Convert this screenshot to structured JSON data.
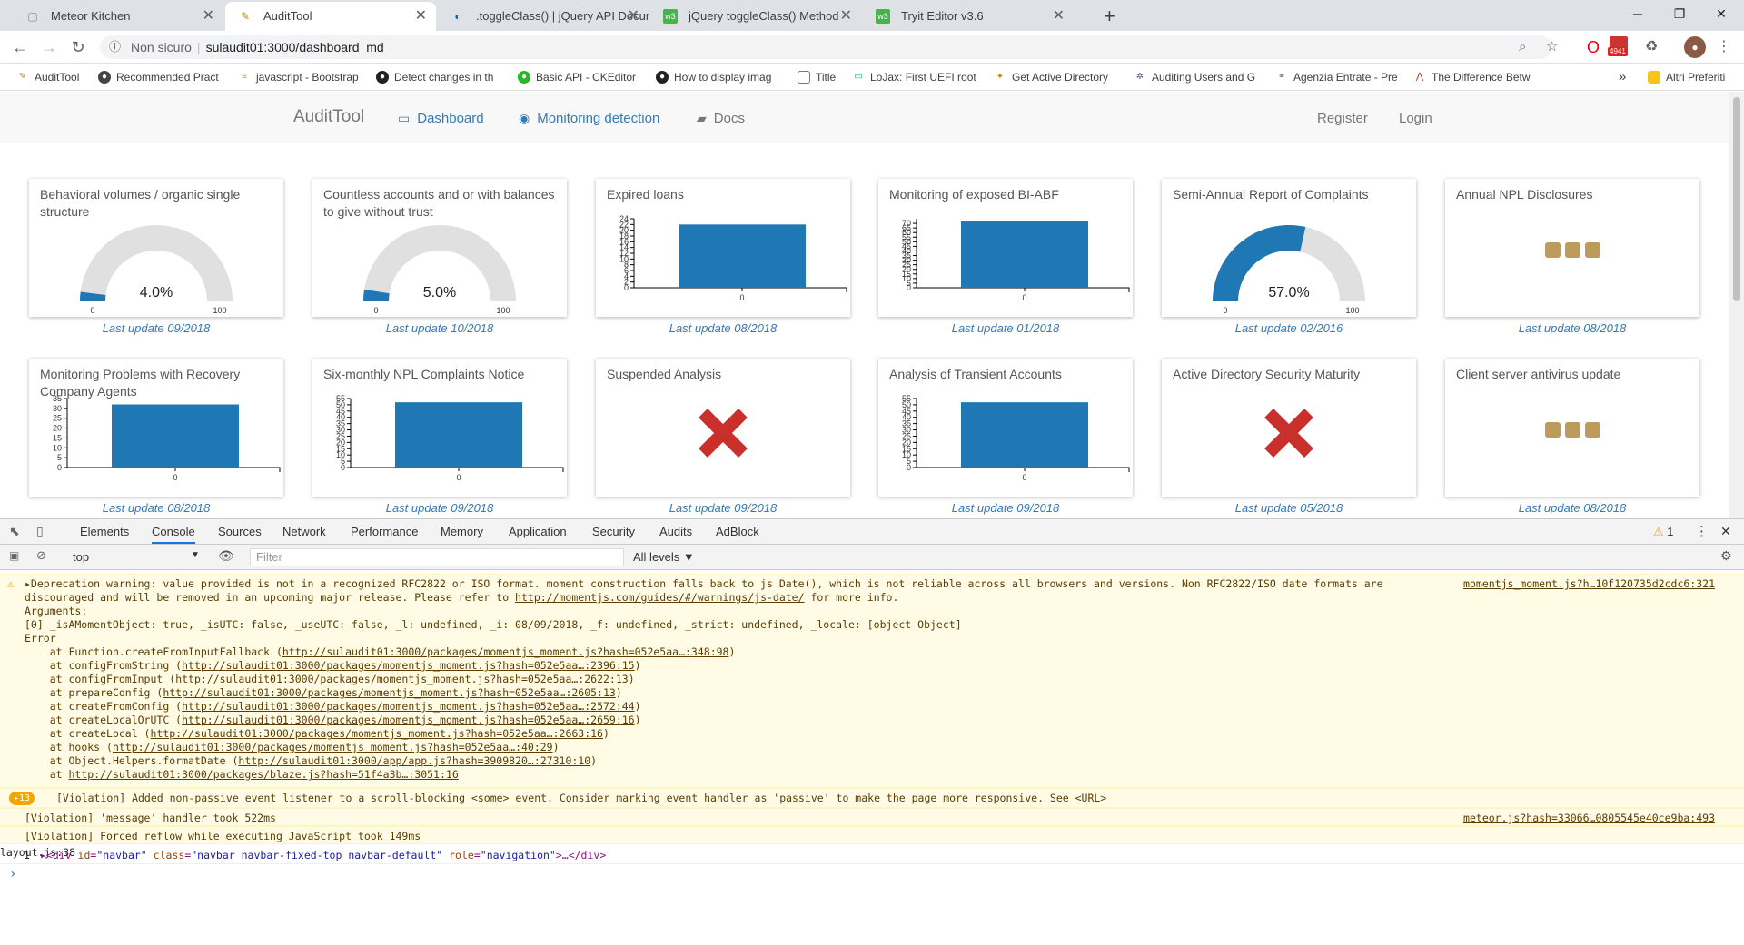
{
  "browser": {
    "tabs": [
      {
        "title": "Meteor Kitchen",
        "active": false
      },
      {
        "title": "AuditTool",
        "active": true
      },
      {
        "title": ".toggleClass() | jQuery API Docum",
        "active": false
      },
      {
        "title": "jQuery toggleClass() Method",
        "active": false
      },
      {
        "title": "Tryit Editor v3.6",
        "active": false
      }
    ],
    "url_security": "Non sicuro",
    "url": "sulaudit01:3000/dashboard_md",
    "ext_badge": "4941",
    "bookmarks": [
      "AuditTool",
      "Recommended Pract",
      "javascript - Bootstrap",
      "Detect changes in th",
      "Basic API - CKEditor",
      "How to display imag",
      "Title",
      "LoJax: First UEFI root",
      "Get Active Directory",
      "Auditing Users and G",
      "Agenzia Entrate - Pre",
      "The Difference Betw"
    ],
    "bookmarks_overflow": "»",
    "other_bookmarks": "Altri Preferiti"
  },
  "navbar": {
    "brand": "AuditTool",
    "dashboard": "Dashboard",
    "monitoring": "Monitoring detection",
    "docs": "Docs",
    "register": "Register",
    "login": "Login"
  },
  "widgets": [
    {
      "title": "Behavioral volumes / organic single structure",
      "type": "gauge",
      "value": 4.0,
      "label": "4.0%",
      "min": "0",
      "max": "100",
      "update": "Last update 09/2018"
    },
    {
      "title": "Countless accounts and or with balances to give without trust",
      "type": "gauge",
      "value": 5.0,
      "label": "5.0%",
      "min": "0",
      "max": "100",
      "update": "Last update 10/2018"
    },
    {
      "title": "Expired loans",
      "type": "bar",
      "value": 22,
      "ymax": 24,
      "ticks": [
        "0",
        "2",
        "4",
        "6",
        "8",
        "10",
        "12",
        "14",
        "16",
        "18",
        "20",
        "22",
        "24"
      ],
      "xcat": "0",
      "update": "Last update 08/2018"
    },
    {
      "title": "Monitoring of exposed BI-ABF",
      "type": "bar",
      "value": 72,
      "ymax": 75,
      "ticks": [
        "0",
        "5",
        "10",
        "15",
        "20",
        "25",
        "30",
        "35",
        "40",
        "45",
        "50",
        "55",
        "60",
        "65",
        "70"
      ],
      "xcat": "0",
      "update": "Last update 01/2018"
    },
    {
      "title": "Semi-Annual Report of Complaints",
      "type": "gauge",
      "value": 57.0,
      "label": "57.0%",
      "min": "0",
      "max": "100",
      "update": "Last update 02/2016"
    },
    {
      "title": "Annual NPL Disclosures",
      "type": "loading",
      "update": "Last update 08/2018"
    },
    {
      "title": "Monitoring Problems with Recovery Company Agents",
      "type": "bar",
      "value": 32,
      "ymax": 35,
      "ticks": [
        "0",
        "5",
        "10",
        "15",
        "20",
        "25",
        "30",
        "35"
      ],
      "xcat": "0",
      "update": "Last update 08/2018"
    },
    {
      "title": "Six-monthly NPL Complaints Notice",
      "type": "bar",
      "value": 52,
      "ymax": 55,
      "ticks": [
        "0",
        "5",
        "10",
        "15",
        "20",
        "25",
        "30",
        "35",
        "40",
        "45",
        "50",
        "55"
      ],
      "xcat": "0",
      "update": "Last update 09/2018"
    },
    {
      "title": "Suspended Analysis",
      "type": "error",
      "update": "Last update 09/2018"
    },
    {
      "title": "Analysis of Transient Accounts",
      "type": "bar",
      "value": 52,
      "ymax": 55,
      "ticks": [
        "0",
        "5",
        "10",
        "15",
        "20",
        "25",
        "30",
        "35",
        "40",
        "45",
        "50",
        "55"
      ],
      "xcat": "0",
      "update": "Last update 09/2018"
    },
    {
      "title": "Active Directory Security Maturity",
      "type": "error",
      "update": "Last update 05/2018"
    },
    {
      "title": "Client server antivirus update",
      "type": "loading",
      "update": "Last update 08/2018"
    }
  ],
  "devtools": {
    "tabs": [
      "Elements",
      "Console",
      "Sources",
      "Network",
      "Performance",
      "Memory",
      "Application",
      "Security",
      "Audits",
      "AdBlock"
    ],
    "active_tab": "Console",
    "warn_count": "1",
    "context": "top",
    "filter_placeholder": "Filter",
    "levels": "All levels ▼",
    "warning": {
      "text_pre": "▸Deprecation warning: value provided is not in a recognized RFC2822 or ISO format. moment construction falls back to js Date(), which is not reliable across all browsers and versions. Non RFC2822/ISO date formats are discouraged and will be removed in an upcoming major release. Please refer to ",
      "link": "http://momentjs.com/guides/#/warnings/js-date/",
      "text_post": " for more info.",
      "source": "momentjs_moment.js?h…10f120735d2cdc6:321",
      "args_label": "Arguments:",
      "args": "[0] _isAMomentObject: true, _isUTC: false, _useUTC: false, _l: undefined, _i: 08/09/2018, _f: undefined, _strict: undefined, _locale: [object Object]",
      "error_label": "Error",
      "stack": [
        {
          "fn": "at Function.createFromInputFallback (",
          "url": "http://sulaudit01:3000/packages/momentjs_moment.js?hash=052e5aa…:348:98",
          "end": ")"
        },
        {
          "fn": "at configFromString (",
          "url": "http://sulaudit01:3000/packages/momentjs_moment.js?hash=052e5aa…:2396:15",
          "end": ")"
        },
        {
          "fn": "at configFromInput (",
          "url": "http://sulaudit01:3000/packages/momentjs_moment.js?hash=052e5aa…:2622:13",
          "end": ")"
        },
        {
          "fn": "at prepareConfig (",
          "url": "http://sulaudit01:3000/packages/momentjs_moment.js?hash=052e5aa…:2605:13",
          "end": ")"
        },
        {
          "fn": "at createFromConfig (",
          "url": "http://sulaudit01:3000/packages/momentjs_moment.js?hash=052e5aa…:2572:44",
          "end": ")"
        },
        {
          "fn": "at createLocalOrUTC (",
          "url": "http://sulaudit01:3000/packages/momentjs_moment.js?hash=052e5aa…:2659:16",
          "end": ")"
        },
        {
          "fn": "at createLocal (",
          "url": "http://sulaudit01:3000/packages/momentjs_moment.js?hash=052e5aa…:2663:16",
          "end": ")"
        },
        {
          "fn": "at hooks (",
          "url": "http://sulaudit01:3000/packages/momentjs_moment.js?hash=052e5aa…:40:29",
          "end": ")"
        },
        {
          "fn": "at Object.Helpers.formatDate (",
          "url": "http://sulaudit01:3000/app/app.js?hash=3909820…:27310:10",
          "end": ")"
        },
        {
          "fn": "at ",
          "url": "http://sulaudit01:3000/packages/blaze.js?hash=51f4a3b…:3051:16",
          "end": ""
        }
      ]
    },
    "violation_badge": "▸13",
    "violation1": "[Violation] Added non-passive event listener to a scroll-blocking <some> event. Consider marking event handler as 'passive' to make the page more responsive. See <URL>",
    "violation2": "[Violation] 'message' handler took 522ms",
    "violation2_source": "meteor.js?hash=33066…0805545e40ce9ba:493",
    "violation3": "[Violation] Forced reflow while executing JavaScript took 149ms",
    "log_count": "1",
    "log_source": "layout.js:38",
    "log_element": {
      "open": "▸<div ",
      "id_attr": "id",
      "id_val": "\"navbar\"",
      "class_attr": "class",
      "class_val": "\"navbar navbar-fixed-top navbar-default\"",
      "role_attr": "role",
      "role_val": "\"navigation\"",
      "close": ">…</div>"
    },
    "prompt": "›"
  }
}
